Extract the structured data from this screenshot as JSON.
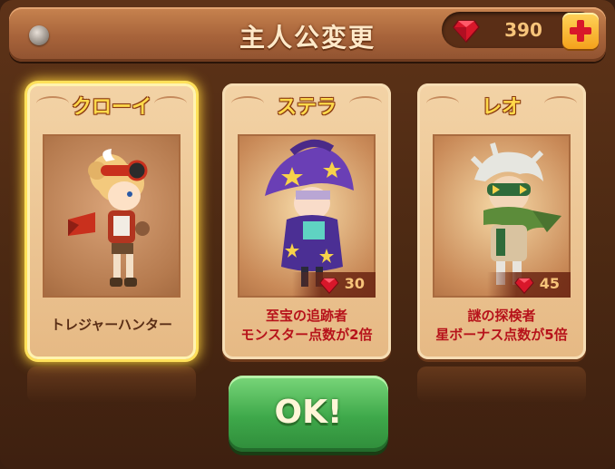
{
  "header": {
    "title": "主人公変更",
    "gem_count": "390"
  },
  "characters": [
    {
      "name": "クローイ",
      "description": "トレジャーハンター",
      "selected": true
    },
    {
      "name": "ステラ",
      "price": "30",
      "description_line1": "至宝の追跡者",
      "description_line2": "モンスター点数が2倍"
    },
    {
      "name": "レオ",
      "price": "45",
      "description_line1": "謎の探検者",
      "description_line2": "星ボーナス点数が5倍"
    }
  ],
  "ok_button": {
    "label": "OK!"
  },
  "colors": {
    "accent_gold": "#ffd94a",
    "description_red": "#b7131b",
    "ok_green": "#3ea84a",
    "gem_red": "#d8172a"
  }
}
